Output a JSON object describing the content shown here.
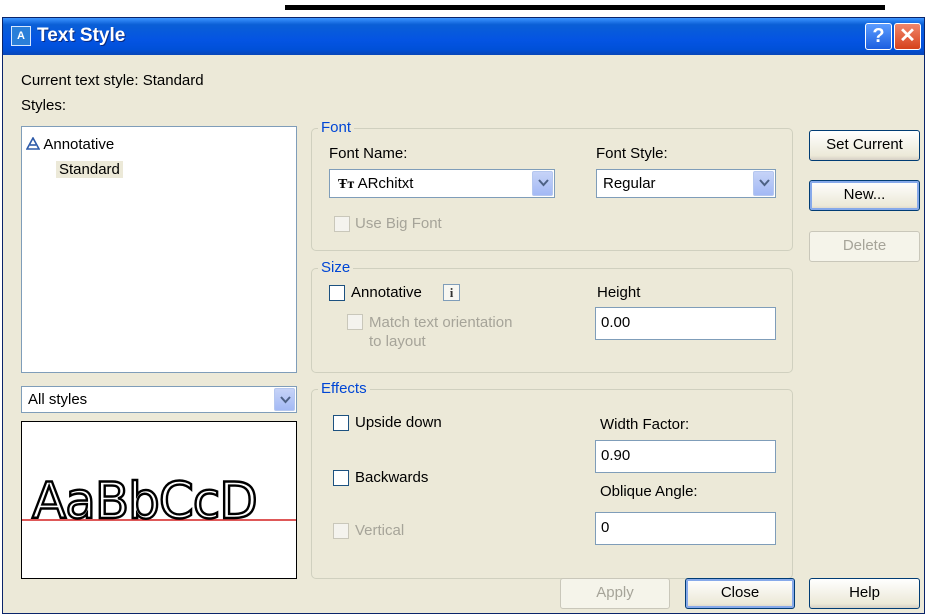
{
  "window": {
    "title": "Text Style",
    "help_symbol": "?",
    "close_symbol": "✕"
  },
  "current_style": {
    "label": "Current text style:",
    "value": "Standard"
  },
  "styles": {
    "label": "Styles:",
    "items": [
      {
        "label": "Annotative",
        "annotative": true
      },
      {
        "label": "Standard",
        "selected": true
      }
    ],
    "filter_value": "All styles"
  },
  "preview": {
    "sample_text": "AaBbCcD",
    "baseline_color": "#d32020"
  },
  "font_group": {
    "legend": "Font",
    "font_name_label": "Font Name:",
    "font_name_value": "ARchitxt",
    "font_style_label": "Font Style:",
    "font_style_value": "Regular",
    "use_big_font_label": "Use Big Font"
  },
  "size_group": {
    "legend": "Size",
    "annotative_label": "Annotative",
    "info_symbol": "i",
    "match_orientation_label_line1": "Match text orientation",
    "match_orientation_label_line2": "to layout",
    "height_label": "Height",
    "height_value": "0.00"
  },
  "effects_group": {
    "legend": "Effects",
    "upside_down_label": "Upside down",
    "backwards_label": "Backwards",
    "vertical_label": "Vertical",
    "width_factor_label": "Width Factor:",
    "width_factor_value": "0.90",
    "oblique_label": "Oblique Angle:",
    "oblique_value": "0"
  },
  "buttons": {
    "set_current": "Set Current",
    "new": "New...",
    "delete": "Delete",
    "apply": "Apply",
    "close": "Close",
    "help": "Help"
  },
  "colors": {
    "titlebar": "#0454e3",
    "dialog_bg": "#ece9d8",
    "group_legend": "#0046d5"
  },
  "icons": {
    "window_icon": "text-style-app-icon",
    "truetype": "truetype-font-icon",
    "annotative": "annotative-scale-icon"
  }
}
